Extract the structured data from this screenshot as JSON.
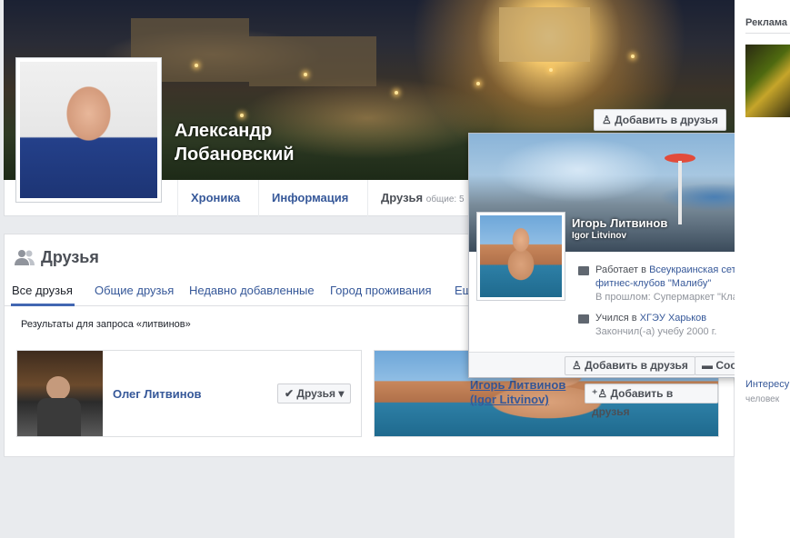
{
  "profile": {
    "name_line1": "Александр",
    "name_line2": "Лобановский",
    "add_friend_label": "Добавить в друзья",
    "tabs": [
      "Хроника",
      "Информация",
      "Друзья"
    ],
    "friends_tab_extra": "общие: 5"
  },
  "friends_section": {
    "title": "Друзья",
    "subtabs": [
      "Все друзья",
      "Общие друзья",
      "Недавно добавленные",
      "Город проживания",
      "Ещ"
    ],
    "query": "Результаты для запроса «литвинов»",
    "results": [
      {
        "name": "Олег Литвинов",
        "button": "Друзья"
      },
      {
        "name_line1": "Игорь Литвинов",
        "name_line2": "(Igor Litvinov)",
        "button": "Добавить в друзья"
      }
    ]
  },
  "hovercard": {
    "name": "Игорь Литвинов",
    "alt_name": "Igor Litvinov",
    "work_prefix": "Работает в",
    "work_link_line1": "Всеукраинская сеть",
    "work_link_line2": "фитнес-клубов \"Малибу\"",
    "work_past": "В прошлом: Супермаркет \"Класс\"",
    "edu_prefix": "Учился в",
    "edu_link": "ХГЭУ Харьков",
    "edu_sub": "Закончил(-а) учебу 2000 г.",
    "add_friend_label": "Добавить в друзья",
    "message_label": "Сообщение"
  },
  "ads": {
    "title": "Реклама",
    "text1": "Интересу",
    "text2": "человек"
  }
}
